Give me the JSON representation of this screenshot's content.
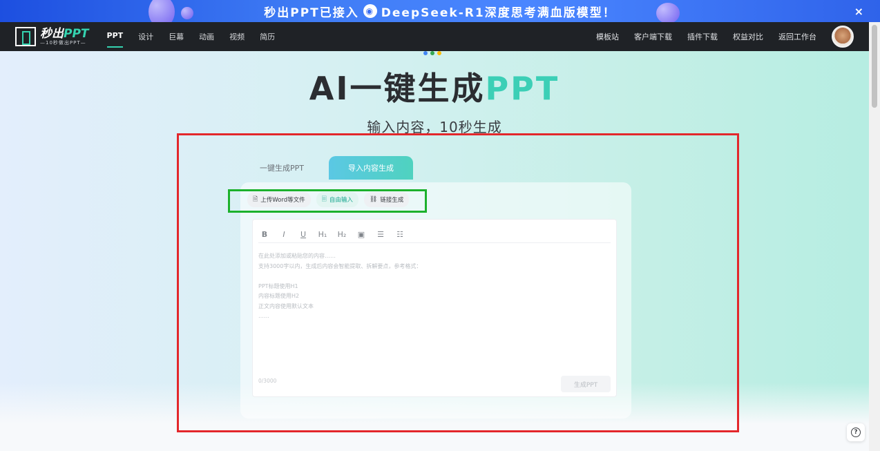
{
  "banner": {
    "text_pre": "秒出PPT已接入",
    "text_post": "DeepSeek-R1深度思考满血版模型！",
    "close": "×"
  },
  "nav": {
    "logo_name": "秒出",
    "logo_ppt": "PPT",
    "logo_sub": "—10秒做出PPT—",
    "items": [
      "PPT",
      "设计",
      "巨幕",
      "动画",
      "视频",
      "简历"
    ],
    "right_links": [
      "模板站",
      "客户端下载",
      "插件下载",
      "权益对比",
      "返回工作台"
    ]
  },
  "hero": {
    "title": "AI一键生成",
    "title_accent": "PPT",
    "subtitle": "输入内容，10秒生成"
  },
  "tabs": {
    "tab1": "一键生成PPT",
    "tab2": "导入内容生成"
  },
  "modes": {
    "upload": "上传Word等文件",
    "free_input": "自由输入",
    "link": "链接生成"
  },
  "editor": {
    "toolbar": [
      "B",
      "I",
      "U",
      "H₁",
      "H₂",
      "▣",
      "☰",
      "☷"
    ],
    "placeholder": "在此处添加或粘贴您的内容……\n支持3000字以内，生成后内容会智能提取、拆解要点，参考格式：\n\nPPT标题使用H1\n内容标题使用H2\n正文内容使用默认文本\n……",
    "count": "0/3000",
    "generate": "生成PPT"
  },
  "colors": {
    "accent": "#3ccfb6",
    "red_box": "#e3272b",
    "green_box": "#1cb12c"
  },
  "help": "?"
}
